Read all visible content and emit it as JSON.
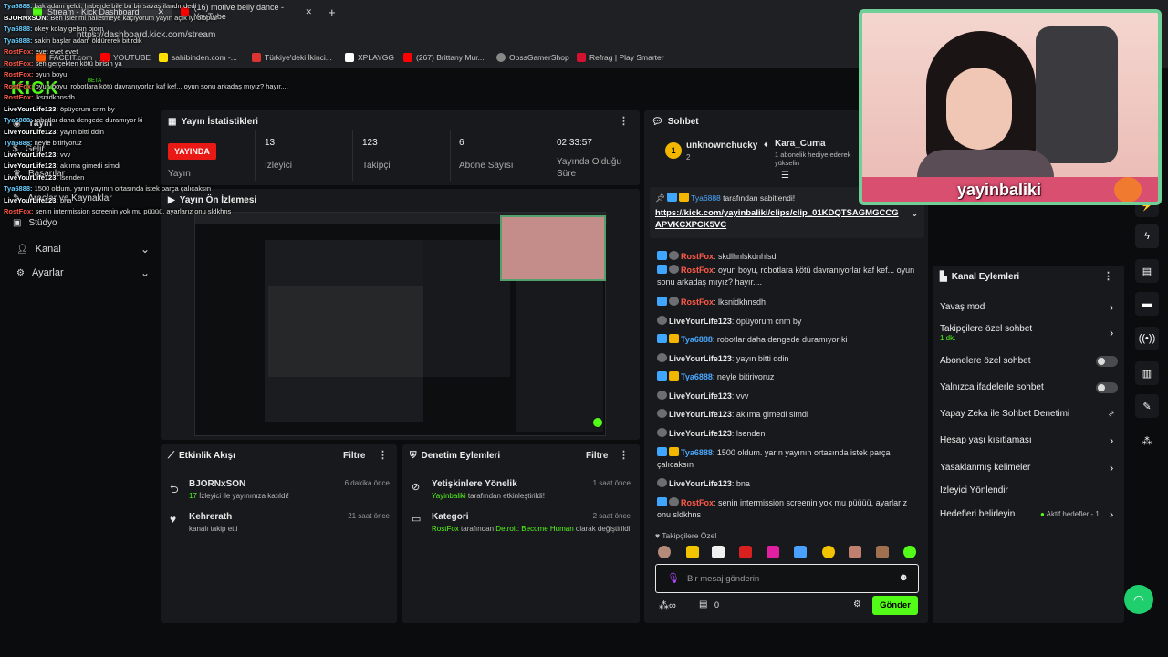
{
  "browser": {
    "tabs": [
      {
        "title": "Stream - Kick Dashboard"
      },
      {
        "title": "(16) motive belly dance - YouTube"
      }
    ],
    "new_tab": "+",
    "url": "https://dashboard.kick.com/stream",
    "bookmarks": [
      "FACEIT.com",
      "YOUTUBE",
      "sahibinden.com -...",
      "Türkiye'deki İkinci...",
      "XPLAYGG",
      "(267) Brittany Mur...",
      "OpssGamerShop",
      "Refrag | Play Smarter"
    ]
  },
  "overlay_chat": [
    {
      "user": "Tya6888",
      "text": "bak adam geldi. haberde bile bu bir savaş ilandır dedi",
      "color": "blue"
    },
    {
      "user": "BJORNxSON",
      "text": "Ben işlerimi halletmeye kaçıyorum yayın açık iyi bloplar",
      "color": "white"
    },
    {
      "user": "Tya6888",
      "text": "okey kolay gelsin bjorn",
      "color": "blue"
    },
    {
      "user": "Tya6888",
      "text": "sakin başlar adam öldürerek bitirdik",
      "color": "blue"
    },
    {
      "user": "RostFox",
      "text": "evet evet evet",
      "color": "red"
    },
    {
      "user": "RostFox",
      "text": "sen gerçekten kötü birisin ya",
      "color": "red"
    },
    {
      "user": "RostFox",
      "text": "oyun boyu",
      "color": "red"
    },
    {
      "user": "RostFox",
      "text": "oyun boyu, robotlara kötü davranıyorlar kaf kef... oyun sonu arkadaş mıyız? hayır....",
      "color": "red"
    },
    {
      "user": "RostFox",
      "text": "lksnidkhnsdh",
      "color": "red"
    },
    {
      "user": "LiveYourLife123",
      "text": "öpüyorum cnm by",
      "color": "white"
    },
    {
      "user": "Tya6888",
      "text": "robotlar daha dengede duramıyor ki",
      "color": "blue"
    },
    {
      "user": "LiveYourLife123",
      "text": "yayın bitti ddin",
      "color": "white"
    },
    {
      "user": "Tya6888",
      "text": "neyle bitiriyoruz",
      "color": "blue"
    },
    {
      "user": "LiveYourLife123",
      "text": "vvv",
      "color": "white"
    },
    {
      "user": "LiveYourLife123",
      "text": "aklıma gimedi simdi",
      "color": "white"
    },
    {
      "user": "LiveYourLife123",
      "text": "lsenden",
      "color": "white"
    },
    {
      "user": "Tya6888",
      "text": "1500 oldum. yarın yayının ortasında istek parça çalıcaksın",
      "color": "blue"
    },
    {
      "user": "LiveYourLife123",
      "text": "bna",
      "color": "white"
    },
    {
      "user": "RostFox",
      "text": "senin intermission screenin yok mu püüüü, ayarlarız onu sldkhns",
      "color": "red"
    }
  ],
  "sidebar": {
    "logo": "KICK",
    "beta": "BETA",
    "items": [
      {
        "label": "Yayın",
        "icon": "broadcast-icon"
      },
      {
        "label": "Gelir",
        "icon": "dollar-icon"
      },
      {
        "label": "Başarılar",
        "icon": "trophy-icon"
      },
      {
        "label": "Araçlar ve Kaynaklar",
        "icon": "tools-icon"
      },
      {
        "label": "Stüdyo",
        "icon": "studio-icon"
      },
      {
        "label": "Kanal",
        "icon": "user-icon"
      },
      {
        "label": "Ayarlar",
        "icon": "gear-icon"
      }
    ]
  },
  "stats": {
    "title": "Yayın İstatistikleri",
    "live_badge": "YAYINDA",
    "live_label": "Yayın",
    "items": [
      {
        "value": "13",
        "label": "İzleyici"
      },
      {
        "value": "123",
        "label": "Takipçi"
      },
      {
        "value": "6",
        "label": "Abone Sayısı"
      },
      {
        "value": "02:33:57",
        "label": "Yayında Olduğu Süre"
      }
    ]
  },
  "preview": {
    "title": "Yayın Ön İzlemesi"
  },
  "activity": {
    "title": "Etkinlik Akışı",
    "filter": "Filtre",
    "items": [
      {
        "icon": "raid-icon",
        "name": "BJORNxSON",
        "time": "6 dakika önce",
        "highlight": "17",
        "detail": "İzleyici ile yayınınıza katıldı!"
      },
      {
        "icon": "heart-icon",
        "name": "Kehrerath",
        "time": "21 saat önce",
        "highlight": "",
        "detail": "kanalı takip etti"
      }
    ]
  },
  "moderation": {
    "title": "Denetim Eylemleri",
    "filter": "Filtre",
    "items": [
      {
        "icon": "eye-off-icon",
        "title": "Yetişkinlere Yönelik",
        "time": "1 saat önce",
        "actor": "Yayinbaliki",
        "detail": "tarafından etkinleştirildi!"
      },
      {
        "icon": "folder-icon",
        "title": "Kategori",
        "time": "2 saat önce",
        "actor": "RostFox",
        "detail_mid": "tarafından",
        "value": "Detroit: Become Human",
        "detail_end": "olarak değiştirildi!"
      }
    ]
  },
  "chat": {
    "title": "Sohbet",
    "gifters": [
      {
        "name": "unknownchucky",
        "count": "2"
      },
      {
        "name": "Kara_Cuma",
        "sub": "1 abonelik hediye ederek yükselin"
      }
    ],
    "pinned": {
      "by": "Tya6888",
      "label": "tarafından sabitlendi!",
      "link": "https://kick.com/yayinbaliki/clips/clip_01KDQTSAGMGCCGAPVKCXPCK5VC"
    },
    "messages": [
      {
        "user": "RostFox",
        "text": "skdlhnlskdnhlsd",
        "color": "#ff5a4a",
        "badges": [
          "mod",
          "sub"
        ]
      },
      {
        "user": "RostFox",
        "text": "oyun boyu, robotlara kötü davranıyorlar kaf kef... oyun sonu arkadaş mıyız? hayır....",
        "color": "#ff5a4a",
        "badges": [
          "mod",
          "sub"
        ]
      },
      {
        "user": "RostFox",
        "text": "lksnidkhnsdh",
        "color": "#ff5a4a",
        "badges": [
          "mod",
          "sub"
        ]
      },
      {
        "user": "LiveYourLife123",
        "text": "öpüyorum cnm by",
        "color": "#e6e6e6",
        "badges": [
          "sub"
        ]
      },
      {
        "user": "Tya6888",
        "text": "robotlar daha dengede duramıyor ki",
        "color": "#4aa8ff",
        "badges": [
          "mod",
          "crown"
        ]
      },
      {
        "user": "LiveYourLife123",
        "text": "yayın bitti ddin",
        "color": "#e6e6e6",
        "badges": [
          "sub"
        ]
      },
      {
        "user": "Tya6888",
        "text": "neyle bitiriyoruz",
        "color": "#4aa8ff",
        "badges": [
          "mod",
          "crown"
        ]
      },
      {
        "user": "LiveYourLife123",
        "text": "vvv",
        "color": "#e6e6e6",
        "badges": [
          "sub"
        ]
      },
      {
        "user": "LiveYourLife123",
        "text": "aklıma gimedi simdi",
        "color": "#e6e6e6",
        "badges": [
          "sub"
        ]
      },
      {
        "user": "LiveYourLife123",
        "text": "lsenden",
        "color": "#e6e6e6",
        "badges": [
          "sub"
        ]
      },
      {
        "user": "Tya6888",
        "text": "1500 oldum. yarın yayının ortasında istek parça çalıcaksın",
        "color": "#4aa8ff",
        "badges": [
          "mod",
          "crown"
        ]
      },
      {
        "user": "LiveYourLife123",
        "text": "bna",
        "color": "#e6e6e6",
        "badges": [
          "sub"
        ]
      },
      {
        "user": "RostFox",
        "text": "senin intermission screenin yok mu püüüü, ayarlarız onu sldkhns",
        "color": "#ff5a4a",
        "badges": [
          "mod",
          "sub"
        ]
      }
    ],
    "followers_only": "Takipçilere Özel",
    "input_placeholder": "Bir mesaj gönderin",
    "points": "0",
    "send": "Gönder"
  },
  "channel_actions": {
    "title": "Kanal Eylemleri",
    "items": [
      {
        "label": "Yavaş mod",
        "control": "chevron"
      },
      {
        "label": "Takipçilere özel sohbet",
        "sub": "1 dk.",
        "control": "chevron"
      },
      {
        "label": "Abonelere özel sohbet",
        "control": "toggle"
      },
      {
        "label": "Yalnızca ifadelerle sohbet",
        "control": "toggle"
      },
      {
        "label": "Yapay Zeka ile Sohbet Denetimi",
        "control": "external"
      },
      {
        "label": "Hesap yaşı kısıtlaması",
        "control": "chevron"
      },
      {
        "label": "Yasaklanmış kelimeler",
        "control": "chevron"
      },
      {
        "label": "İzleyici Yönlendir",
        "control": "none"
      },
      {
        "label": "Hedefleri belirleyin",
        "control": "chevron",
        "status": "Aktif hedefler - 1"
      }
    ]
  },
  "webcam": {
    "brand": "yayinbaliki"
  },
  "colors": {
    "accent": "#53fc18",
    "live": "#e91916",
    "panel": "#18191c",
    "background": "#0b0c0d"
  }
}
